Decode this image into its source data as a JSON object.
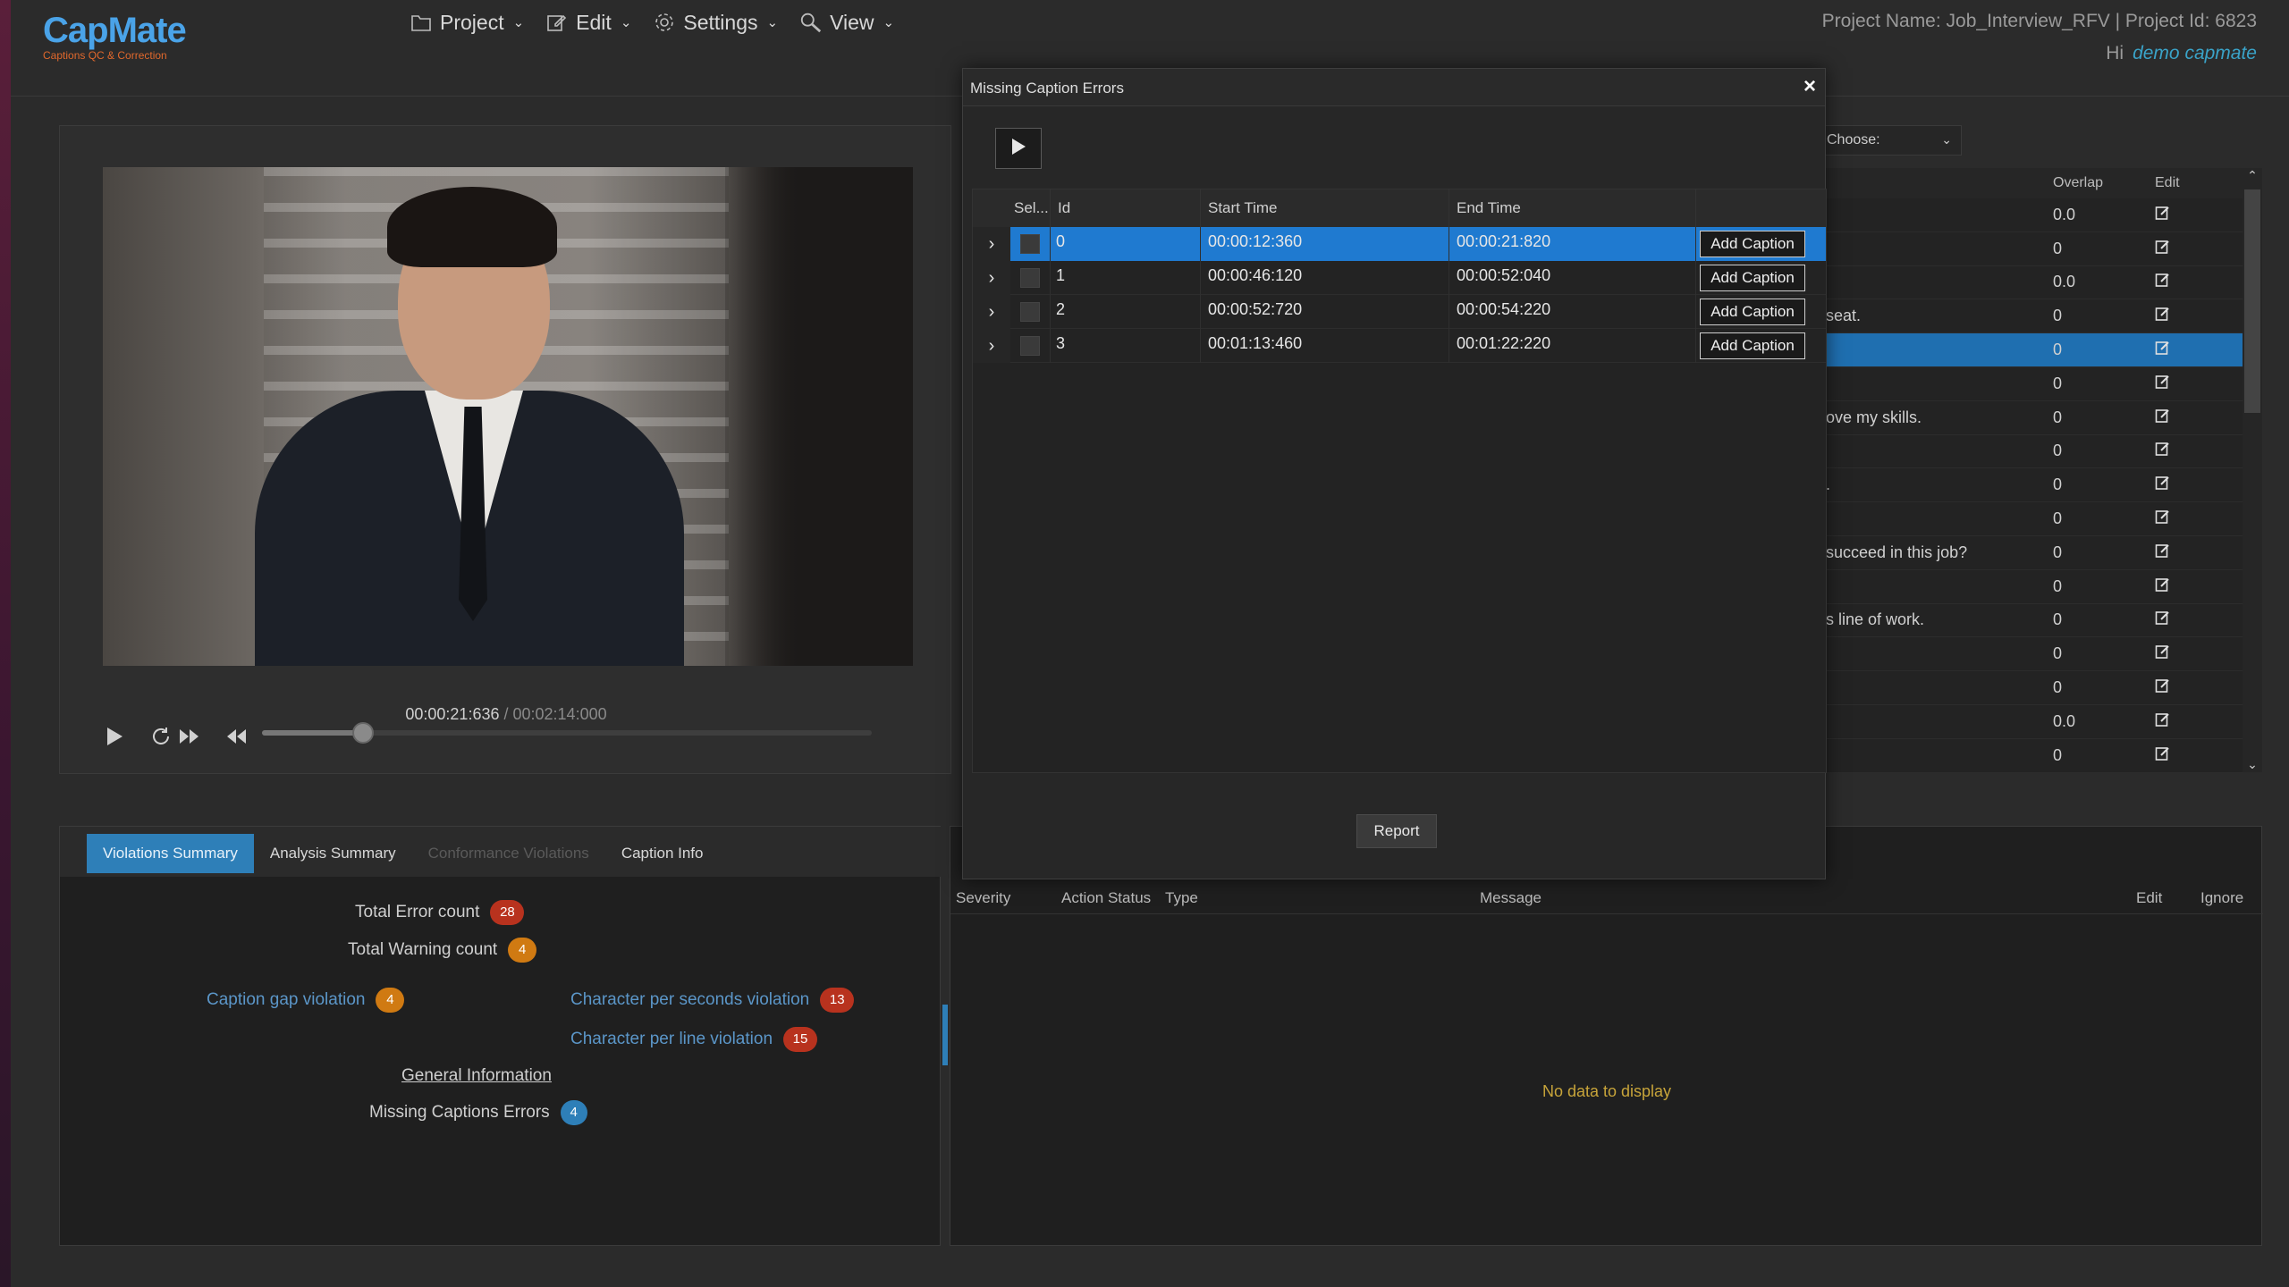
{
  "app": {
    "logo_name": "CapMate",
    "logo_tagline": "Captions QC & Correction",
    "project_info": "Project Name: Job_Interview_RFV | Project Id: 6823",
    "greeting": "Hi",
    "username": "demo capmate"
  },
  "menu": [
    {
      "label": "Project",
      "icon": "folder-icon"
    },
    {
      "label": "Edit",
      "icon": "edit-icon"
    },
    {
      "label": "Settings",
      "icon": "gear-icon"
    },
    {
      "label": "View",
      "icon": "search-icon"
    }
  ],
  "player": {
    "current_time": "00:00:21:636",
    "separator": " / ",
    "total_time": "00:02:14:000",
    "progress": 0.165
  },
  "violations_tabs": [
    "Violations Summary",
    "Analysis Summary",
    "Conformance Violations",
    "Caption Info"
  ],
  "violations": {
    "total_error_label": "Total Error count",
    "total_error_count": "28",
    "total_warning_label": "Total Warning count",
    "total_warning_count": "4",
    "caption_gap_label": "Caption gap violation",
    "caption_gap_count": "4",
    "cps_label": "Character per seconds violation",
    "cps_count": "13",
    "cpl_label": "Character per line violation",
    "cpl_count": "15",
    "general_info_label": "General Information",
    "missing_captions_label": "Missing Captions Errors",
    "missing_captions_count": "4"
  },
  "caption_table": {
    "choose_label": "Choose:",
    "headers": {
      "overlap": "Overlap",
      "edit": "Edit"
    },
    "rows": [
      {
        "text": "",
        "overlap": "0.0"
      },
      {
        "text": "",
        "overlap": "0"
      },
      {
        "text": "",
        "overlap": "0.0"
      },
      {
        "text": "seat.",
        "overlap": "0"
      },
      {
        "text": "",
        "overlap": "0",
        "selected": true
      },
      {
        "text": "",
        "overlap": "0"
      },
      {
        "text": "ove my skills.",
        "overlap": "0"
      },
      {
        "text": "",
        "overlap": "0"
      },
      {
        "text": ".",
        "overlap": "0"
      },
      {
        "text": "",
        "overlap": "0"
      },
      {
        "text": "succeed in this job?",
        "overlap": "0"
      },
      {
        "text": "",
        "overlap": "0"
      },
      {
        "text": "s line of work.",
        "overlap": "0"
      },
      {
        "text": "",
        "overlap": "0"
      },
      {
        "text": "",
        "overlap": "0"
      },
      {
        "text": "",
        "overlap": "0.0"
      },
      {
        "text": "",
        "overlap": "0"
      }
    ]
  },
  "issues": {
    "headers": {
      "severity": "Severity",
      "action_status": "Action Status",
      "type": "Type",
      "message": "Message",
      "edit": "Edit",
      "ignore": "Ignore"
    },
    "empty_text": "No data to display"
  },
  "modal": {
    "title": "Missing Caption Errors",
    "headers": {
      "sel": "Sel...",
      "id": "Id",
      "start": "Start Time",
      "end": "End Time"
    },
    "rows": [
      {
        "id": "0",
        "start": "00:00:12:360",
        "end": "00:00:21:820",
        "action": "Add Caption",
        "selected": true
      },
      {
        "id": "1",
        "start": "00:00:46:120",
        "end": "00:00:52:040",
        "action": "Add Caption"
      },
      {
        "id": "2",
        "start": "00:00:52:720",
        "end": "00:00:54:220",
        "action": "Add Caption"
      },
      {
        "id": "3",
        "start": "00:01:13:460",
        "end": "00:01:22:220",
        "action": "Add Caption"
      }
    ],
    "report_label": "Report",
    "close_glyph": "×"
  }
}
